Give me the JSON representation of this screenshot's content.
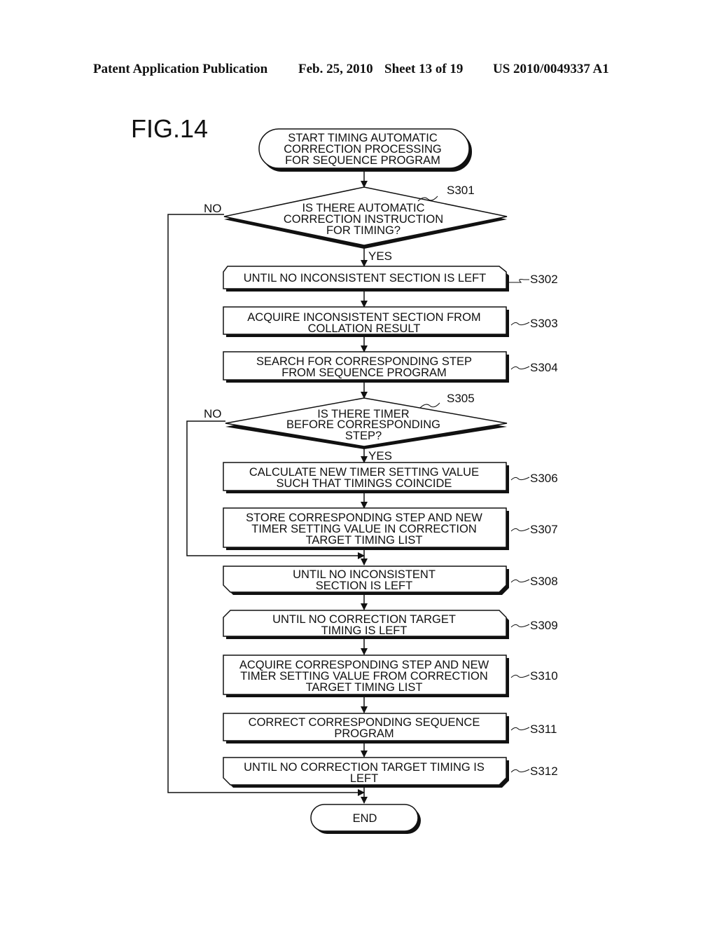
{
  "header": {
    "publication": "Patent Application Publication",
    "date": "Feb. 25, 2010",
    "sheet": "Sheet 13 of 19",
    "number": "US 2010/0049337 A1"
  },
  "figure": {
    "title": "FIG.14"
  },
  "flowchart": {
    "start": {
      "lines": [
        "START TIMING AUTOMATIC",
        "CORRECTION PROCESSING",
        "FOR SEQUENCE PROGRAM"
      ]
    },
    "s301": {
      "step": "S301",
      "lines": [
        "IS THERE AUTOMATIC",
        "CORRECTION INSTRUCTION",
        "FOR TIMING?"
      ],
      "yes": "YES",
      "no": "NO"
    },
    "s302": {
      "step": "S302",
      "lines": [
        "UNTIL NO INCONSISTENT SECTION IS LEFT"
      ]
    },
    "s303": {
      "step": "S303",
      "lines": [
        "ACQUIRE INCONSISTENT SECTION FROM",
        "COLLATION RESULT"
      ]
    },
    "s304": {
      "step": "S304",
      "lines": [
        "SEARCH FOR CORRESPONDING STEP",
        "FROM SEQUENCE PROGRAM"
      ]
    },
    "s305": {
      "step": "S305",
      "lines": [
        "IS THERE TIMER",
        "BEFORE CORRESPONDING",
        "STEP?"
      ],
      "yes": "YES",
      "no": "NO"
    },
    "s306": {
      "step": "S306",
      "lines": [
        "CALCULATE NEW TIMER SETTING VALUE",
        "SUCH THAT TIMINGS COINCIDE"
      ]
    },
    "s307": {
      "step": "S307",
      "lines": [
        "STORE CORRESPONDING STEP AND NEW",
        "TIMER SETTING VALUE IN CORRECTION",
        "TARGET TIMING LIST"
      ]
    },
    "s308": {
      "step": "S308",
      "lines": [
        "UNTIL NO INCONSISTENT",
        "SECTION IS LEFT"
      ]
    },
    "s309": {
      "step": "S309",
      "lines": [
        "UNTIL NO CORRECTION TARGET",
        "TIMING IS LEFT"
      ]
    },
    "s310": {
      "step": "S310",
      "lines": [
        "ACQUIRE CORRESPONDING STEP AND NEW",
        "TIMER SETTING VALUE FROM CORRECTION",
        "TARGET TIMING LIST"
      ]
    },
    "s311": {
      "step": "S311",
      "lines": [
        "CORRECT CORRESPONDING SEQUENCE",
        "PROGRAM"
      ]
    },
    "s312": {
      "step": "S312",
      "lines": [
        "UNTIL NO CORRECTION TARGET TIMING IS",
        "LEFT"
      ]
    },
    "end": {
      "lines": [
        "END"
      ]
    }
  }
}
